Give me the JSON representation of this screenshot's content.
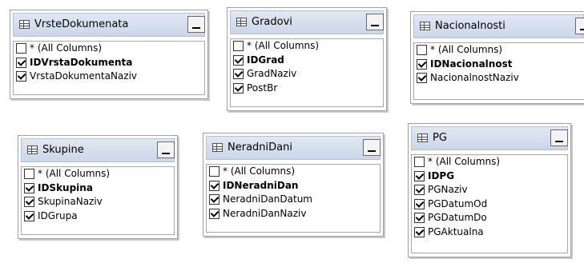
{
  "tables": [
    {
      "id": "vrstedokumenata",
      "title": "VrsteDokumenata",
      "columns": [
        {
          "label": "* (All Columns)",
          "checked": false,
          "key": false
        },
        {
          "label": "IDVrstaDokumenta",
          "checked": true,
          "key": true
        },
        {
          "label": "VrstaDokumentaNaziv",
          "checked": true,
          "key": false
        }
      ]
    },
    {
      "id": "gradovi",
      "title": "Gradovi",
      "columns": [
        {
          "label": "* (All Columns)",
          "checked": false,
          "key": false
        },
        {
          "label": "IDGrad",
          "checked": true,
          "key": true
        },
        {
          "label": "GradNaziv",
          "checked": true,
          "key": false
        },
        {
          "label": "PostBr",
          "checked": true,
          "key": false
        }
      ]
    },
    {
      "id": "nacionalnosti",
      "title": "Nacionalnosti",
      "columns": [
        {
          "label": "* (All Columns)",
          "checked": false,
          "key": false
        },
        {
          "label": "IDNacionalnost",
          "checked": true,
          "key": true
        },
        {
          "label": "NacionalnostNaziv",
          "checked": true,
          "key": false
        }
      ]
    },
    {
      "id": "skupine",
      "title": "Skupine",
      "columns": [
        {
          "label": "* (All Columns)",
          "checked": false,
          "key": false
        },
        {
          "label": "IDSkupina",
          "checked": true,
          "key": true
        },
        {
          "label": "SkupinaNaziv",
          "checked": true,
          "key": false
        },
        {
          "label": "IDGrupa",
          "checked": true,
          "key": false
        }
      ]
    },
    {
      "id": "neradnidani",
      "title": "NeradniDani",
      "columns": [
        {
          "label": "* (All Columns)",
          "checked": false,
          "key": false
        },
        {
          "label": "IDNeradniDan",
          "checked": true,
          "key": true
        },
        {
          "label": "NeradniDanDatum",
          "checked": true,
          "key": false
        },
        {
          "label": "NeradniDanNaziv",
          "checked": true,
          "key": false
        }
      ]
    },
    {
      "id": "pg",
      "title": "PG",
      "columns": [
        {
          "label": "* (All Columns)",
          "checked": false,
          "key": false
        },
        {
          "label": "IDPG",
          "checked": true,
          "key": true
        },
        {
          "label": "PGNaziv",
          "checked": true,
          "key": false
        },
        {
          "label": "PGDatumOd",
          "checked": true,
          "key": false
        },
        {
          "label": "PGDatumDo",
          "checked": true,
          "key": false
        },
        {
          "label": "PGAktualna",
          "checked": true,
          "key": false
        }
      ]
    }
  ],
  "icons": {
    "table": "table-icon",
    "minimize": "minimize-icon",
    "checkbox": "checkbox-icon"
  }
}
